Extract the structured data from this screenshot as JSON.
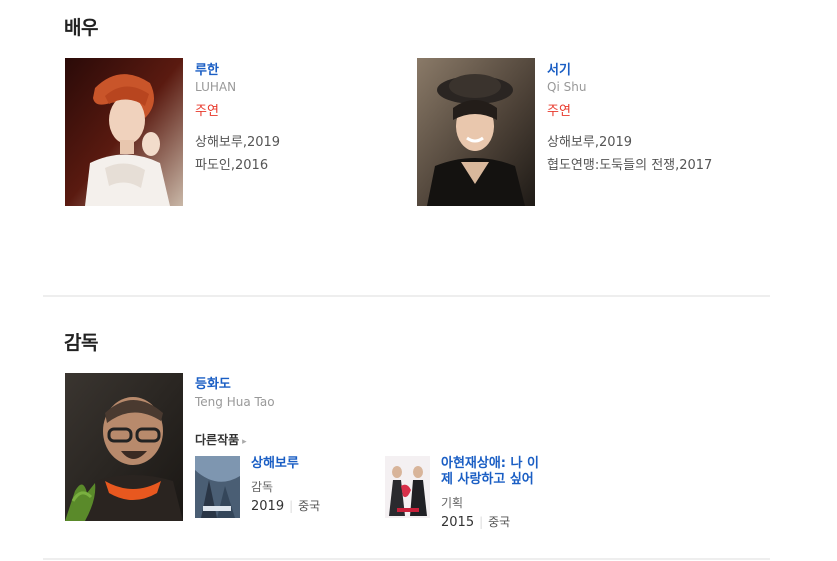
{
  "actors_section": {
    "title": "배우",
    "actors": [
      {
        "name": "루한",
        "english_name": "LUHAN",
        "role": "주연",
        "films": [
          "상해보루,2019",
          "파도인,2016"
        ]
      },
      {
        "name": "서기",
        "english_name": "Qi Shu",
        "role": "주연",
        "films": [
          "상해보루,2019",
          "협도연맹:도둑들의 전쟁,2017"
        ]
      }
    ]
  },
  "director_section": {
    "title": "감독",
    "director": {
      "name": "등화도",
      "english_name": "Teng Hua Tao",
      "other_works_label": "다른작품",
      "works": [
        {
          "title": "상해보루",
          "role": "감독",
          "year": "2019",
          "country": "중국"
        },
        {
          "title": "아현재상애: 나 이\n제 사랑하고 싶어",
          "title_line1": "아현재상애: 나 이",
          "title_line2": "제 사랑하고 싶어",
          "role": "기획",
          "year": "2015",
          "country": "중국"
        }
      ]
    }
  },
  "colors": {
    "link_blue": "#1a5ec4",
    "role_red": "#e8382b",
    "divider": "#eeeeee"
  }
}
